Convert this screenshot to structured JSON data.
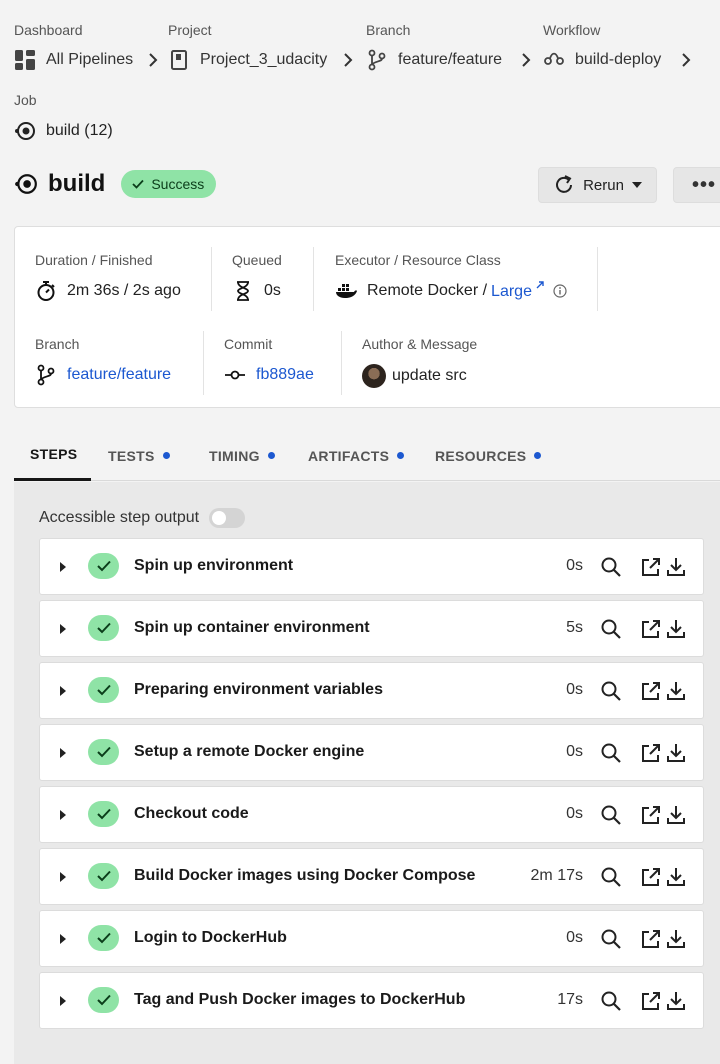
{
  "breadcrumbs": [
    {
      "label": "Dashboard",
      "value": "All Pipelines",
      "icon": "dashboard-icon"
    },
    {
      "label": "Project",
      "value": "Project_3_udacity",
      "icon": "project-icon"
    },
    {
      "label": "Branch",
      "value": "feature/feature",
      "icon": "branch-icon"
    },
    {
      "label": "Workflow",
      "value": "build-deploy",
      "icon": "workflow-icon"
    }
  ],
  "job": {
    "label": "Job",
    "value": "build (12)",
    "icon": "job-icon"
  },
  "header": {
    "title": "build",
    "status": "Success",
    "rerun_label": "Rerun",
    "more_label": "•••"
  },
  "summary": {
    "duration": {
      "label": "Duration / Finished",
      "value": "2m 36s / 2s ago"
    },
    "queued": {
      "label": "Queued",
      "value": "0s"
    },
    "executor": {
      "label": "Executor / Resource Class",
      "value": "Remote Docker /",
      "class_link": "Large"
    },
    "branch": {
      "label": "Branch",
      "value": "feature/feature"
    },
    "commit": {
      "label": "Commit",
      "value": "fb889ae"
    },
    "author": {
      "label": "Author & Message",
      "value": "update src"
    }
  },
  "tabs": [
    {
      "label": "STEPS",
      "active": true,
      "dot": false
    },
    {
      "label": "TESTS",
      "active": false,
      "dot": true
    },
    {
      "label": "TIMING",
      "active": false,
      "dot": true
    },
    {
      "label": "ARTIFACTS",
      "active": false,
      "dot": true
    },
    {
      "label": "RESOURCES",
      "active": false,
      "dot": true
    }
  ],
  "accessible_output": {
    "label": "Accessible step output",
    "enabled": false
  },
  "steps": [
    {
      "name": "Spin up environment",
      "duration": "0s"
    },
    {
      "name": "Spin up container environment",
      "duration": "5s"
    },
    {
      "name": "Preparing environment variables",
      "duration": "0s"
    },
    {
      "name": "Setup a remote Docker engine",
      "duration": "0s"
    },
    {
      "name": "Checkout code",
      "duration": "0s"
    },
    {
      "name": "Build Docker images using Docker Compose",
      "duration": "2m 17s"
    },
    {
      "name": "Login to DockerHub",
      "duration": "0s"
    },
    {
      "name": "Tag and Push Docker images to DockerHub",
      "duration": "17s"
    }
  ],
  "colors": {
    "success": "#8fe3a6",
    "link": "#1c58d0",
    "accent_dot": "#1c58d0"
  }
}
